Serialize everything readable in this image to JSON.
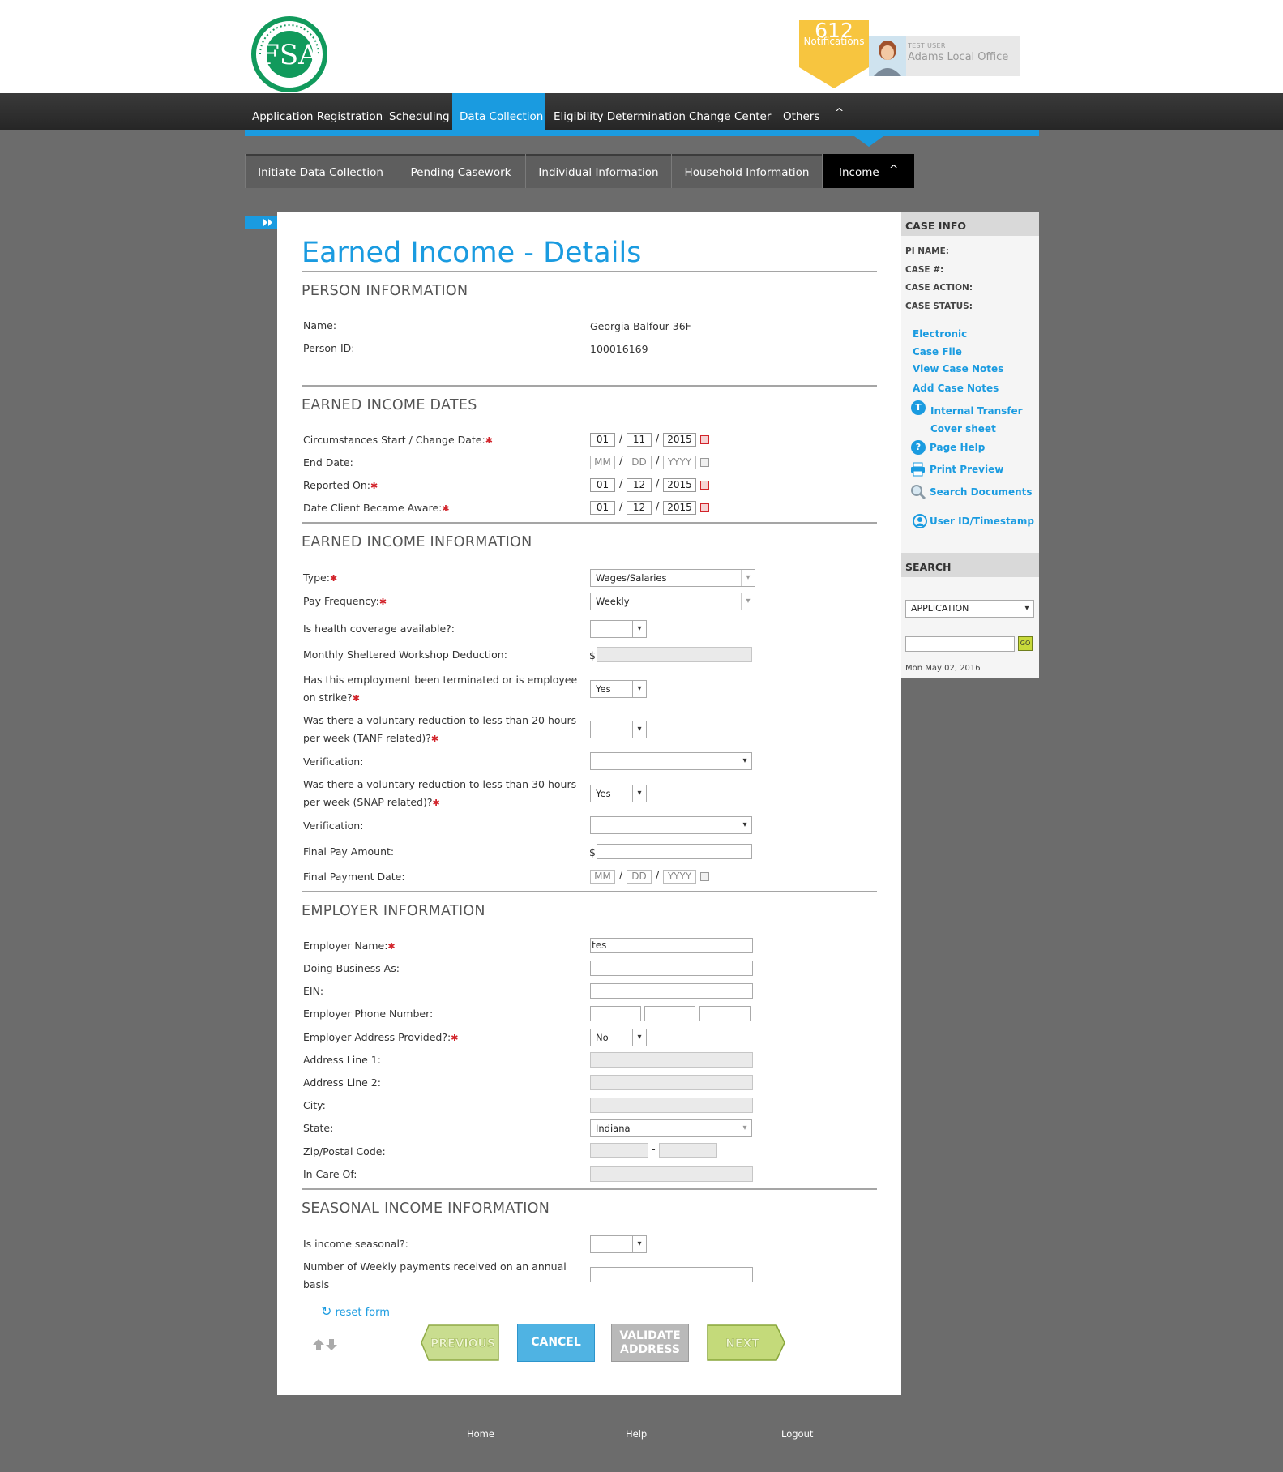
{
  "header": {
    "notification_count": "612",
    "notification_label": "Notifications",
    "user_role": "TEST USER",
    "user_office": "Adams Local Office"
  },
  "main_nav": [
    {
      "label": "Application Registration"
    },
    {
      "label": "Scheduling"
    },
    {
      "label": "Data Collection",
      "active": true
    },
    {
      "label": "Eligibility Determination"
    },
    {
      "label": "Change Center"
    },
    {
      "label": "Others"
    }
  ],
  "main_nav_expand": "^",
  "sub_nav": [
    {
      "label": "Initiate Data Collection"
    },
    {
      "label": "Pending Casework"
    },
    {
      "label": "Individual Information"
    },
    {
      "label": "Household Information"
    },
    {
      "label": "Income",
      "active": true
    }
  ],
  "sub_nav_expand": "^",
  "page": {
    "title": "Earned Income - Details",
    "sections": {
      "person": "PERSON INFORMATION",
      "dates": "EARNED INCOME DATES",
      "info": "EARNED INCOME INFORMATION",
      "employer": "EMPLOYER INFORMATION",
      "seasonal": "SEASONAL INCOME INFORMATION"
    }
  },
  "person": {
    "name_label": "Name:",
    "name_value": "Georgia Balfour 36F",
    "id_label": "Person ID:",
    "id_value": "100016169"
  },
  "dates": {
    "start_label": "Circumstances Start / Change Date:",
    "start": {
      "mm": "01",
      "dd": "11",
      "yyyy": "2015"
    },
    "end_label": "End Date:",
    "end": {
      "mm": "MM",
      "dd": "DD",
      "yyyy": "YYYY"
    },
    "reported_label": "Reported On:",
    "reported": {
      "mm": "01",
      "dd": "12",
      "yyyy": "2015"
    },
    "aware_label": "Date Client Became Aware:",
    "aware": {
      "mm": "01",
      "dd": "12",
      "yyyy": "2015"
    }
  },
  "info": {
    "type_label": "Type:",
    "type_value": "Wages/Salaries",
    "freq_label": "Pay Frequency:",
    "freq_value": "Weekly",
    "health_label": "Is health coverage available?:",
    "health_value": "",
    "workshop_label": "Monthly Sheltered Workshop Deduction:",
    "currency": "$",
    "terminated_label_1": "Has this employment been terminated or is employee",
    "terminated_label_2": "on strike?",
    "terminated_value": "Yes",
    "tanf_label_1": "Was there a voluntary reduction to less than 20 hours",
    "tanf_label_2": "per week (TANF related)?",
    "tanf_value": "",
    "verification_label": "Verification:",
    "snap_label_1": "Was there a voluntary reduction to less than 30 hours",
    "snap_label_2": "per week (SNAP related)?",
    "snap_value": "Yes",
    "verification2_label": "Verification:",
    "final_pay_label": "Final Pay Amount:",
    "final_date_label": "Final Payment Date:",
    "final_date": {
      "mm": "MM",
      "dd": "DD",
      "yyyy": "YYYY"
    }
  },
  "employer": {
    "name_label": "Employer Name:",
    "name_value": "tes",
    "dba_label": "Doing Business As:",
    "ein_label": "EIN:",
    "phone_label": "Employer Phone Number:",
    "address_provided_label": "Employer Address Provided?:",
    "address_provided_value": "No",
    "addr1_label": "Address Line 1:",
    "addr2_label": "Address Line 2:",
    "city_label": "City:",
    "state_label": "State:",
    "state_value": "Indiana",
    "zip_label": "Zip/Postal Code:",
    "zip_sep": "-",
    "care_label": "In Care Of:"
  },
  "seasonal": {
    "seasonal_label": "Is income seasonal?:",
    "seasonal_value": "",
    "weekly_label_1": "Number of Weekly payments received on an annual",
    "weekly_label_2": "basis"
  },
  "actions": {
    "reset": "reset form",
    "previous": "PREVIOUS",
    "cancel": "CANCEL",
    "validate_1": "VALIDATE",
    "validate_2": "ADDRESS",
    "next": "NEXT"
  },
  "sidebar": {
    "case_info_title": "CASE INFO",
    "pi_name": "PI NAME:",
    "case_no": "CASE #:",
    "case_action": "CASE ACTION:",
    "case_status": "CASE STATUS:",
    "links": {
      "electronic": "Electronic",
      "case_file": "Case File",
      "view_notes": "View Case Notes",
      "add_notes": "Add Case Notes",
      "internal_transfer": "Internal Transfer",
      "cover_sheet": "Cover sheet",
      "page_help": "Page Help",
      "print_preview": "Print Preview",
      "search_documents": "Search Documents",
      "user_id": "User ID/Timestamp"
    },
    "search_title": "SEARCH",
    "search_select": "APPLICATION",
    "go": "GO",
    "date": "Mon May 02, 2016"
  },
  "footer": {
    "home": "Home",
    "help": "Help",
    "logout": "Logout"
  },
  "colors": {
    "accent": "#1a9be0",
    "required": "#d2232a",
    "notification": "#f7c53f",
    "logo": "#119a5c"
  }
}
